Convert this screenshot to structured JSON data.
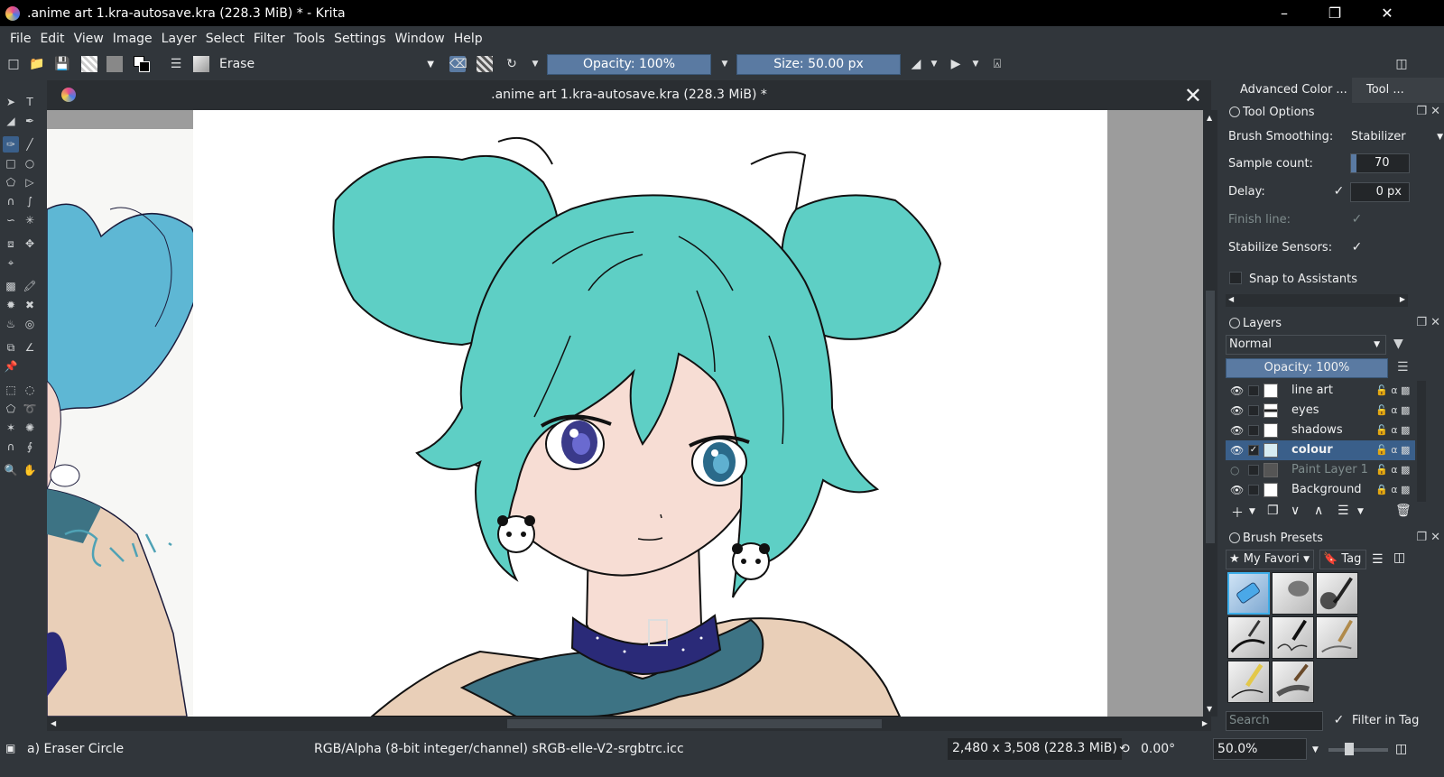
{
  "window": {
    "title": ".anime art 1.kra-autosave.kra (228.3 MiB) * - Krita",
    "minimize_icon": "minimize-icon",
    "restore_icon": "restore-icon",
    "close_icon": "close-icon"
  },
  "menu": [
    "File",
    "Edit",
    "View",
    "Image",
    "Layer",
    "Select",
    "Filter",
    "Tools",
    "Settings",
    "Window",
    "Help"
  ],
  "toolbar": {
    "blend_mode": "Erase",
    "opacity": "Opacity: 100%",
    "size": "Size: 50.00 px"
  },
  "document": {
    "tab_title": ".anime art 1.kra-autosave.kra (228.3 MiB) *"
  },
  "docker": {
    "tabs": [
      "Advanced Color ...",
      "Tool ..."
    ],
    "tool_options": {
      "title": "Tool Options",
      "brush_smoothing_label": "Brush Smoothing:",
      "brush_smoothing_value": "Stabilizer",
      "sample_count_label": "Sample count:",
      "sample_count_value": "70",
      "sample_count_fraction": 0.1,
      "delay_label": "Delay:",
      "delay_value": "0 px",
      "finish_line_label": "Finish line:",
      "stabilize_sensors_label": "Stabilize Sensors:",
      "snap_label": "Snap to Assistants"
    },
    "layers": {
      "title": "Layers",
      "blend": "Normal",
      "opacity": "Opacity: 100%",
      "items": [
        {
          "name": "line art",
          "visible": true,
          "selected": false
        },
        {
          "name": "eyes",
          "visible": true,
          "selected": false
        },
        {
          "name": "shadows",
          "visible": true,
          "selected": false
        },
        {
          "name": "colour",
          "visible": true,
          "selected": true
        },
        {
          "name": "Paint Layer 1",
          "visible": false,
          "selected": false
        },
        {
          "name": "Background",
          "visible": true,
          "selected": false
        }
      ]
    },
    "brush_presets": {
      "title": "Brush Presets",
      "tag": "My Favori",
      "tag_button": "Tag",
      "search_placeholder": "Search",
      "filter_label": "Filter in Tag"
    }
  },
  "status": {
    "tool": "a) Eraser Circle",
    "color_space": "RGB/Alpha (8-bit integer/channel)  sRGB-elle-V2-srgbtrc.icc",
    "dimensions": "2,480 x 3,508 (228.3 MiB)",
    "rotation": "0.00°",
    "zoom": "50.0%"
  },
  "colors": {
    "accent": "#3daee9",
    "hair": "#5ecfc5",
    "skin": "#f7ddd4",
    "shirt": "#e9cfb8",
    "collar": "#3d7384",
    "choker": "#2a2a78"
  }
}
